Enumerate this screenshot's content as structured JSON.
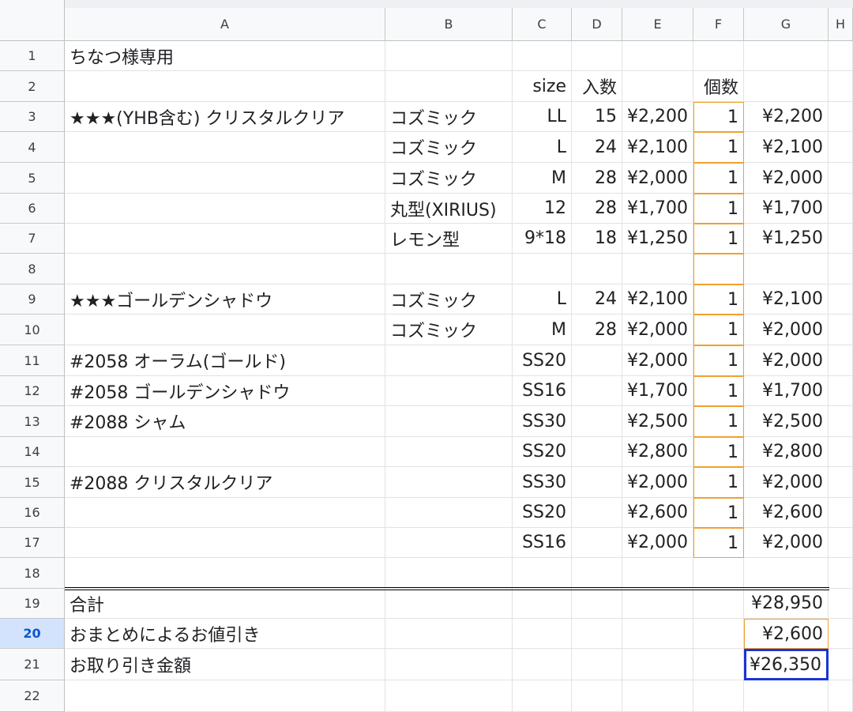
{
  "columns": [
    "A",
    "B",
    "C",
    "D",
    "E",
    "F",
    "G",
    "H"
  ],
  "row_numbers": [
    "1",
    "2",
    "3",
    "4",
    "5",
    "6",
    "7",
    "8",
    "9",
    "10",
    "11",
    "12",
    "13",
    "14",
    "15",
    "16",
    "17",
    "18",
    "19",
    "20",
    "21",
    "22"
  ],
  "selected_row": "20",
  "selected_cell": "G21",
  "accent_colors": {
    "selection": "#1a34d6",
    "highlight_border": "#f0a030",
    "row_header_selected": "#d3e3fd"
  },
  "rows": [
    {
      "A": "ちなつ様専用",
      "B": "",
      "C": "",
      "D": "",
      "E": "",
      "F": "",
      "G": ""
    },
    {
      "A": "",
      "B": "",
      "C": "size",
      "D": "入数",
      "E": "",
      "F": "個数",
      "G": ""
    },
    {
      "A": "★★★(YHB含む) クリスタルクリア",
      "B": "コズミック",
      "C": "LL",
      "D": "15",
      "E": "¥2,200",
      "F": "1",
      "G": "¥2,200"
    },
    {
      "A": "",
      "B": "コズミック",
      "C": "L",
      "D": "24",
      "E": "¥2,100",
      "F": "1",
      "G": "¥2,100"
    },
    {
      "A": "",
      "B": "コズミック",
      "C": "M",
      "D": "28",
      "E": "¥2,000",
      "F": "1",
      "G": "¥2,000"
    },
    {
      "A": "",
      "B": "丸型(XIRIUS)",
      "C": "12",
      "D": "28",
      "E": "¥1,700",
      "F": "1",
      "G": "¥1,700"
    },
    {
      "A": "",
      "B": "レモン型",
      "C": "9*18",
      "D": "18",
      "E": "¥1,250",
      "F": "1",
      "G": "¥1,250"
    },
    {
      "A": "",
      "B": "",
      "C": "",
      "D": "",
      "E": "",
      "F": "",
      "G": ""
    },
    {
      "A": "★★★ゴールデンシャドウ",
      "B": "コズミック",
      "C": "L",
      "D": "24",
      "E": "¥2,100",
      "F": "1",
      "G": "¥2,100"
    },
    {
      "A": "",
      "B": "コズミック",
      "C": "M",
      "D": "28",
      "E": "¥2,000",
      "F": "1",
      "G": "¥2,000"
    },
    {
      "A": "#2058 オーラム(ゴールド)",
      "B": "",
      "C": "SS20",
      "D": "",
      "E": "¥2,000",
      "F": "1",
      "G": "¥2,000"
    },
    {
      "A": "#2058 ゴールデンシャドウ",
      "B": "",
      "C": "SS16",
      "D": "",
      "E": "¥1,700",
      "F": "1",
      "G": "¥1,700"
    },
    {
      "A": "#2088 シャム",
      "B": "",
      "C": "SS30",
      "D": "",
      "E": "¥2,500",
      "F": "1",
      "G": "¥2,500"
    },
    {
      "A": "",
      "B": "",
      "C": "SS20",
      "D": "",
      "E": "¥2,800",
      "F": "1",
      "G": "¥2,800"
    },
    {
      "A": "#2088 クリスタルクリア",
      "B": "",
      "C": "SS30",
      "D": "",
      "E": "¥2,000",
      "F": "1",
      "G": "¥2,000"
    },
    {
      "A": "",
      "B": "",
      "C": "SS20",
      "D": "",
      "E": "¥2,600",
      "F": "1",
      "G": "¥2,600"
    },
    {
      "A": "",
      "B": "",
      "C": "SS16",
      "D": "",
      "E": "¥2,000",
      "F": "1",
      "G": "¥2,000"
    },
    {
      "A": "",
      "B": "",
      "C": "",
      "D": "",
      "E": "",
      "F": "",
      "G": ""
    },
    {
      "A": "合計",
      "B": "",
      "C": "",
      "D": "",
      "E": "",
      "F": "",
      "G": "¥28,950"
    },
    {
      "A": "おまとめによるお値引き",
      "B": "",
      "C": "",
      "D": "",
      "E": "",
      "F": "",
      "G": "¥2,600"
    },
    {
      "A": "お取り引き金額",
      "B": "",
      "C": "",
      "D": "",
      "E": "",
      "F": "",
      "G": "¥26,350"
    },
    {
      "A": "",
      "B": "",
      "C": "",
      "D": "",
      "E": "",
      "F": "",
      "G": ""
    }
  ]
}
